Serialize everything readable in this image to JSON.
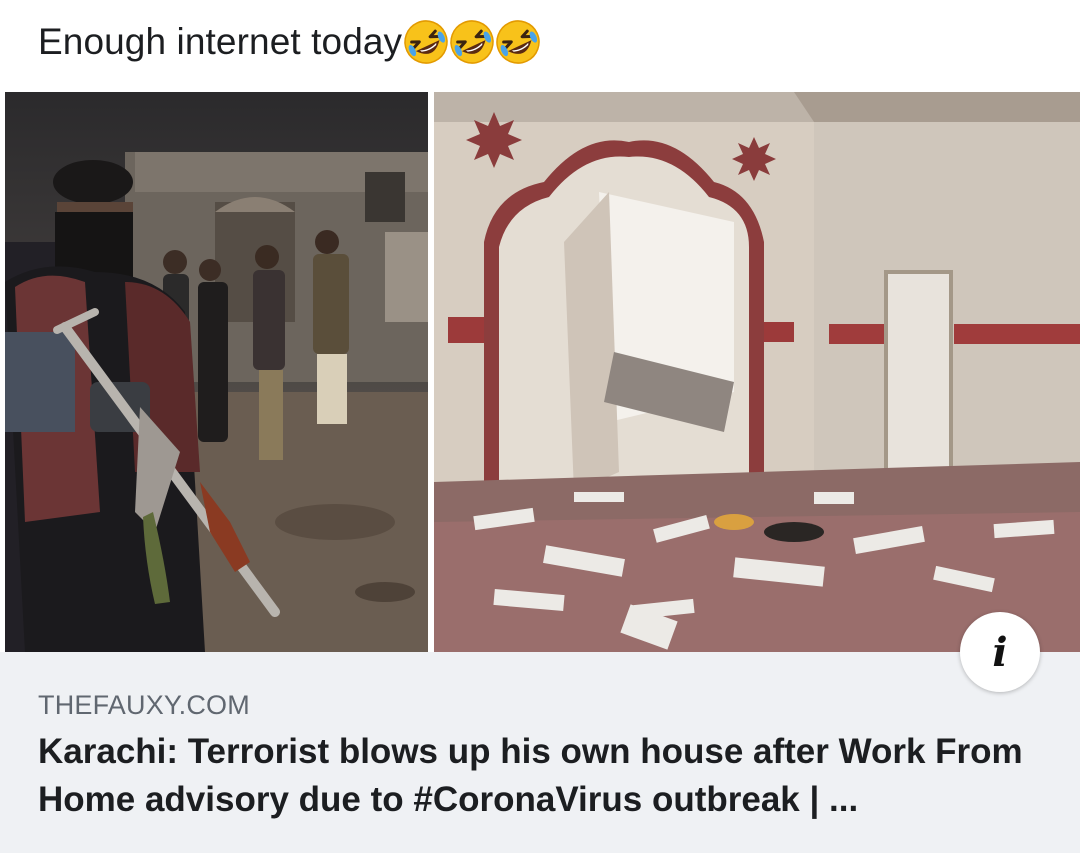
{
  "post": {
    "text": "Enough internet today",
    "emojis": [
      "rolling-on-floor-laughing",
      "rolling-on-floor-laughing",
      "rolling-on-floor-laughing"
    ]
  },
  "link_card": {
    "domain": "THEFAUXY.COM",
    "headline": "Karachi: Terrorist blows up his own house after Work From Home advisory due to #CoronaVirus outbreak | ...",
    "info_icon": "i",
    "images": [
      {
        "description_icon": "armed-man-photo"
      },
      {
        "description_icon": "damaged-room-photo"
      }
    ]
  },
  "colors": {
    "card_background": "#eff1f4",
    "text_primary": "#1c1e21",
    "text_secondary": "#606770"
  }
}
